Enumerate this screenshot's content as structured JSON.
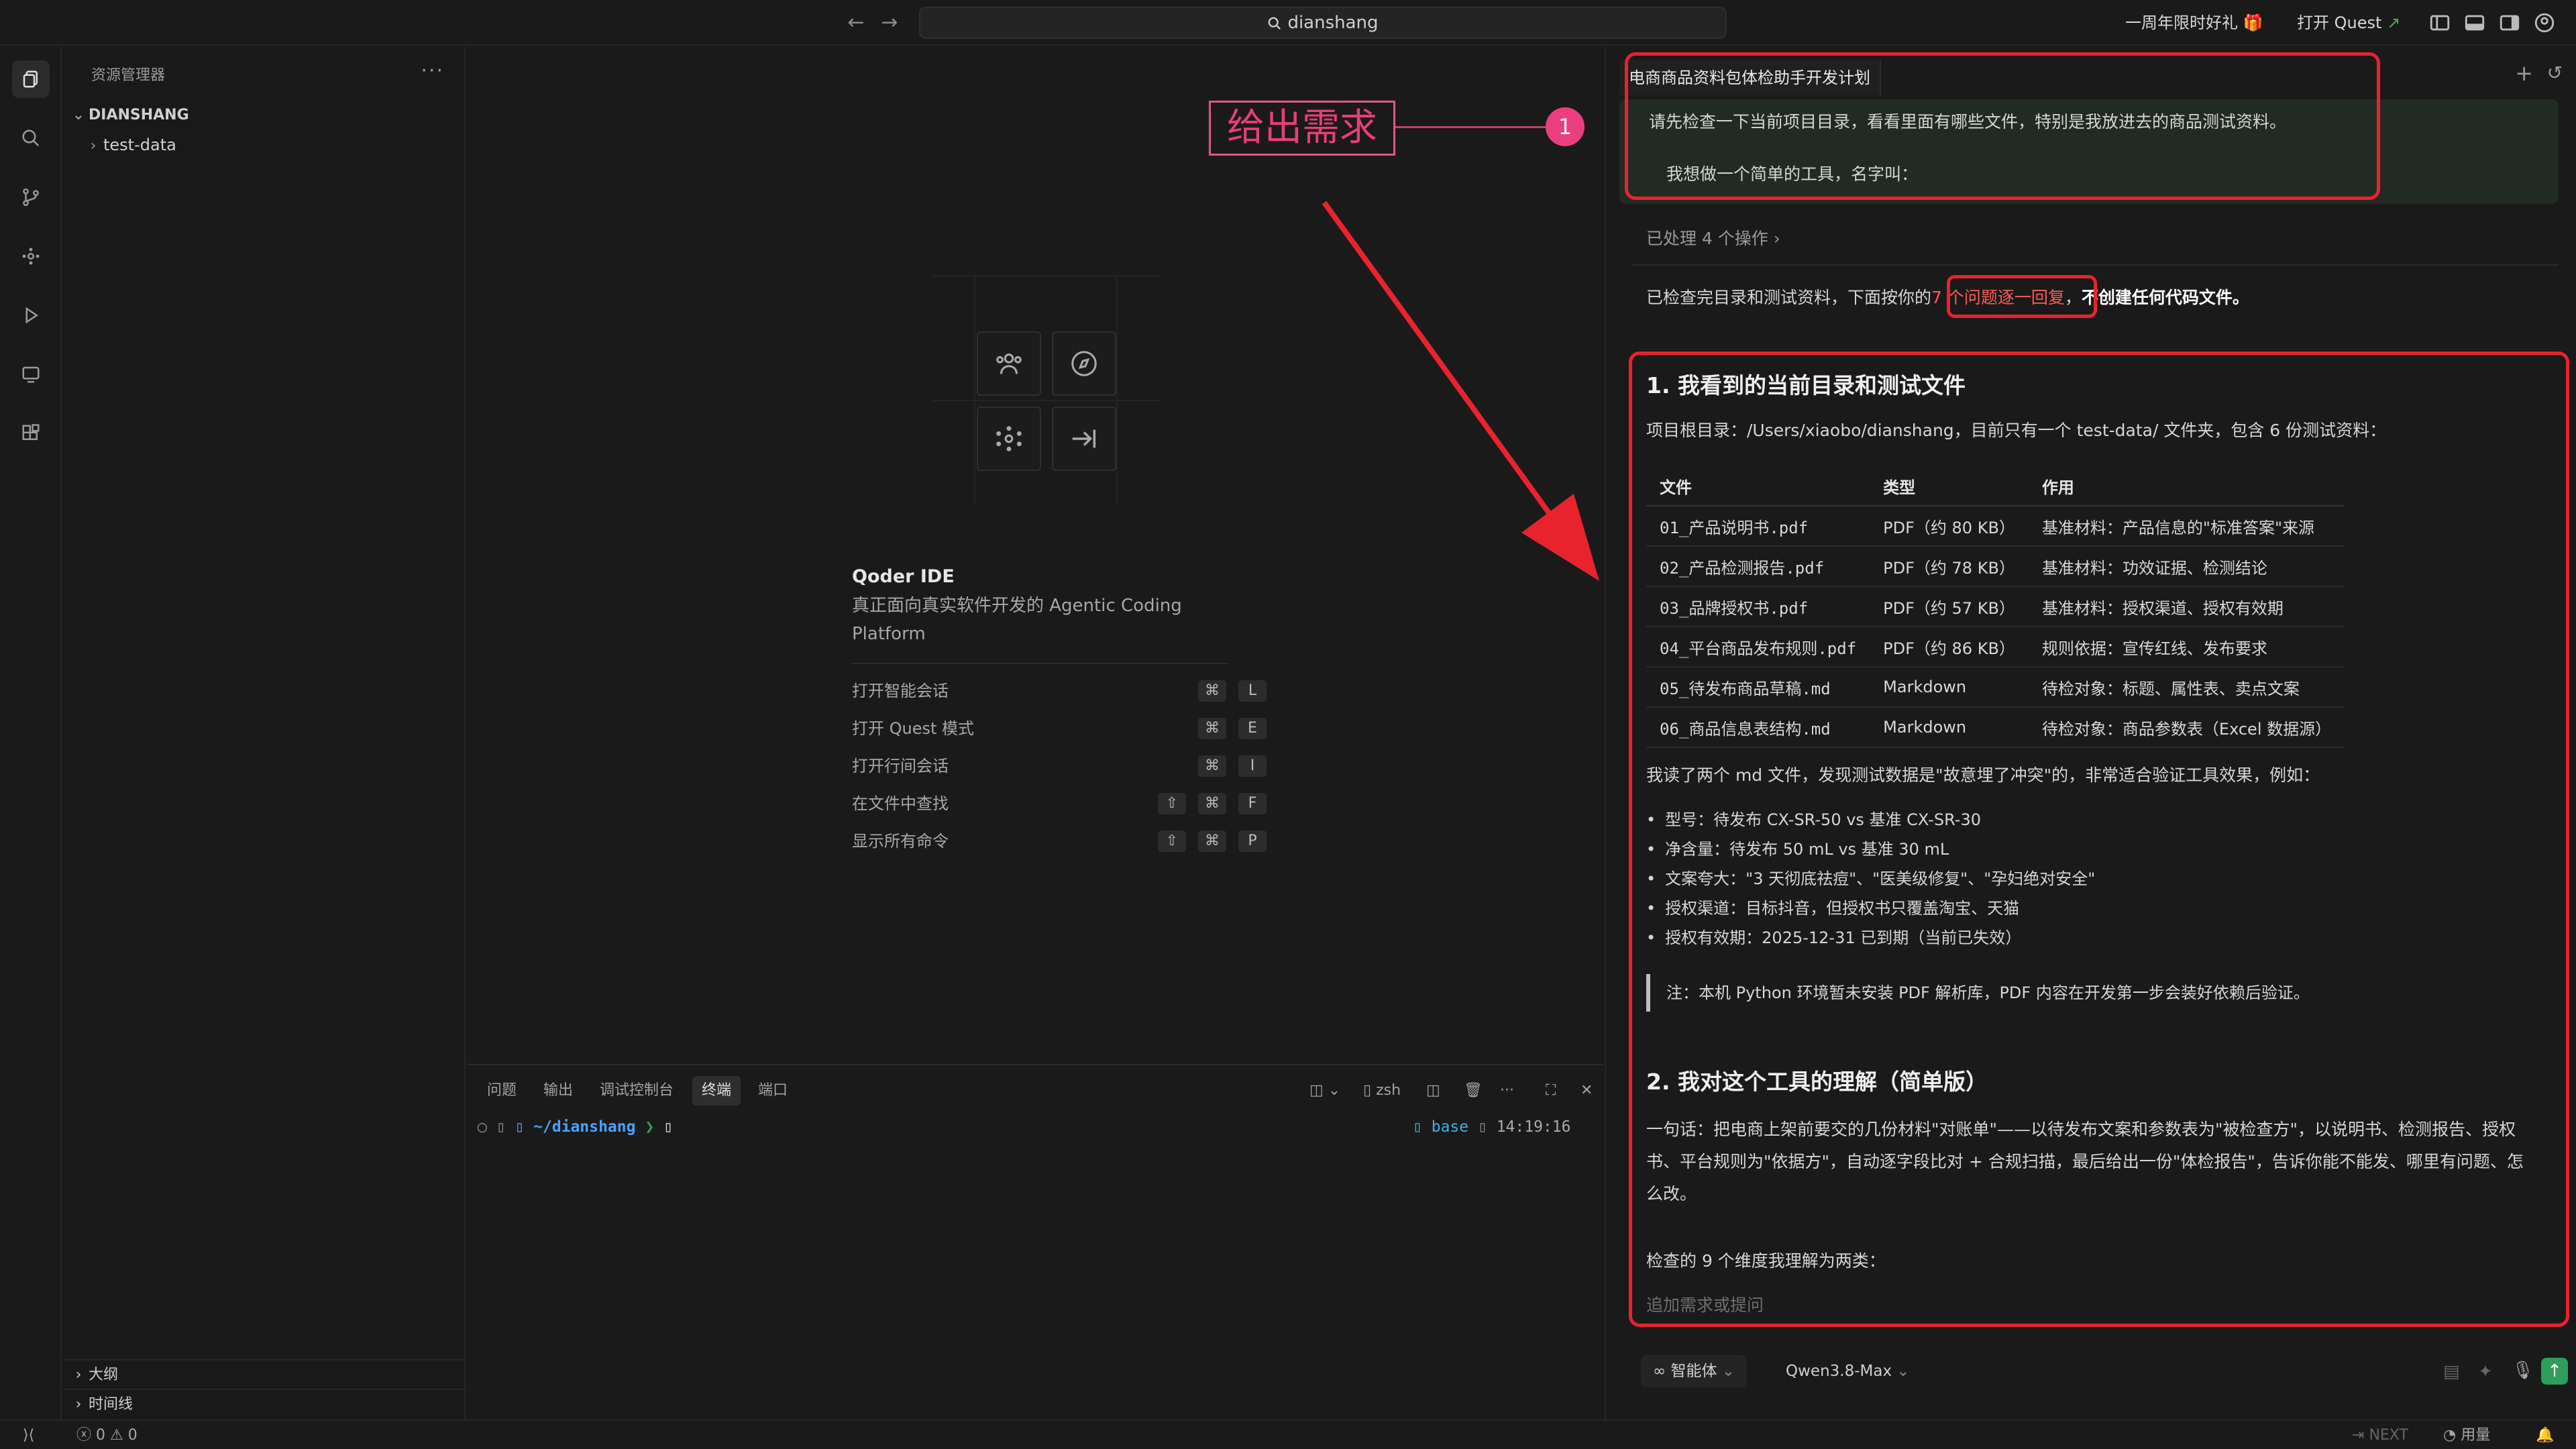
{
  "titlebar": {
    "search_text": "dianshang",
    "promo": "一周年限时好礼",
    "quest_button": "打开 Quest"
  },
  "sidebar": {
    "title": "资源管理器",
    "root": "DIANSHANG",
    "items": [
      {
        "label": "test-data"
      }
    ],
    "outline": "大纲",
    "timeline": "时间线"
  },
  "welcome": {
    "title": "Qoder IDE",
    "subtitle": "真正面向真实软件开发的 Agentic Coding Platform",
    "shortcuts": [
      {
        "label": "打开智能会话",
        "keys": [
          "⌘",
          "L"
        ]
      },
      {
        "label": "打开 Quest 模式",
        "keys": [
          "⌘",
          "E"
        ]
      },
      {
        "label": "打开行间会话",
        "keys": [
          "⌘",
          "I"
        ]
      },
      {
        "label": "在文件中查找",
        "keys": [
          "⇧",
          "⌘",
          "F"
        ]
      },
      {
        "label": "显示所有命令",
        "keys": [
          "⇧",
          "⌘",
          "P"
        ]
      }
    ]
  },
  "annotation": {
    "text": "给出需求",
    "number": "1"
  },
  "panel": {
    "tabs": [
      "问题",
      "输出",
      "调试控制台",
      "终端",
      "端口"
    ],
    "active_tab": "终端",
    "shell": "zsh",
    "prompt_path": "~/dianshang",
    "prompt_symbol": "❯",
    "env": "base",
    "time": "14:19:16"
  },
  "chat": {
    "session_title": "电商商品资料包体检助手开发计划",
    "user_message_line1": "请先检查一下当前项目目录，看看里面有哪些文件，特别是我放进去的商品测试资料。",
    "user_message_line2": "我想做一个简单的工具，名字叫：",
    "processed": "已处理 4 个操作",
    "summary_prefix": "已检查完目录和测试资料，下面按你的",
    "summary_highlight": "7 个问题逐一回复",
    "summary_sep": "，",
    "summary_bold": "不创建任何代码文件。",
    "section1_title": "1. 我看到的当前目录和测试文件",
    "root_line": "项目根目录：/Users/xiaobo/dianshang，目前只有一个 test-data/ 文件夹，包含 6 份测试资料：",
    "table_headers": [
      "文件",
      "类型",
      "作用"
    ],
    "table_rows": [
      [
        "01_产品说明书.pdf",
        "PDF（约 80 KB）",
        "基准材料：产品信息的\"标准答案\"来源"
      ],
      [
        "02_产品检测报告.pdf",
        "PDF（约 78 KB）",
        "基准材料：功效证据、检测结论"
      ],
      [
        "03_品牌授权书.pdf",
        "PDF（约 57 KB）",
        "基准材料：授权渠道、授权有效期"
      ],
      [
        "04_平台商品发布规则.pdf",
        "PDF（约 86 KB）",
        "规则依据：宣传红线、发布要求"
      ],
      [
        "05_待发布商品草稿.md",
        "Markdown",
        "待检对象：标题、属性表、卖点文案"
      ],
      [
        "06_商品信息表结构.md",
        "Markdown",
        "待检对象：商品参数表（Excel 数据源）"
      ]
    ],
    "conflict_line": "我读了两个 md 文件，发现测试数据是\"故意埋了冲突\"的，非常适合验证工具效果，例如：",
    "bullets": [
      "型号：待发布 CX-SR-50 vs 基准 CX-SR-30",
      "净含量：待发布 50 mL vs 基准 30 mL",
      "文案夸大：\"3 天彻底祛痘\"、\"医美级修复\"、\"孕妇绝对安全\"",
      "授权渠道：目标抖音，但授权书只覆盖淘宝、天猫",
      "授权有效期：2025-12-31 已到期（当前已失效）"
    ],
    "note": "注：本机 Python 环境暂未安装 PDF 解析库，PDF 内容在开发第一步会装好依赖后验证。",
    "section2_title": "2. 我对这个工具的理解（简单版）",
    "section2_para_line1": "一句话：把电商上架前要交的几份材料\"对账单\"——以待发布文案和参数表为\"被检查方\"，以说明书、检测报告、授权",
    "section2_para_line2": "书、平台规则为\"依据方\"，自动逐字段比对 + 合规扫描，最后给出一份\"体检报告\"，告诉你能不能发、哪里有问题、怎",
    "section2_para_line3": "么改。",
    "dimensions_line": "检查的 9 个维度我理解为两类：",
    "composer_placeholder": "追加需求或提问",
    "mode": "智能体",
    "model": "Qwen3.8-Max"
  },
  "statusbar": {
    "errors": "0",
    "warnings": "0",
    "next": "NEXT",
    "usage": "用量"
  },
  "colors": {
    "annotation_red": "#e8232e",
    "annotation_pink": "#e83e78",
    "accent_green": "#2f9e5a",
    "prompt_blue": "#4aa3ff"
  }
}
